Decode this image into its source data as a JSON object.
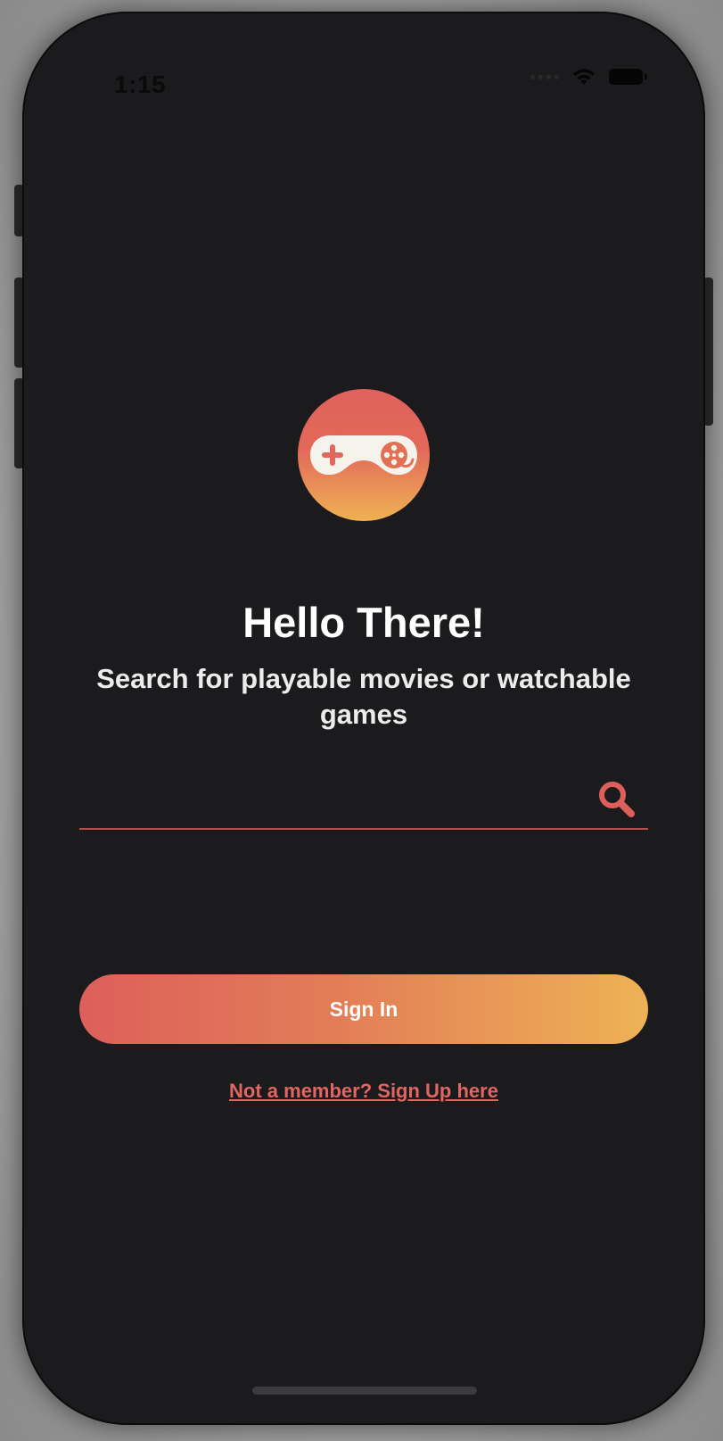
{
  "status_bar": {
    "time": "1:15",
    "icons": [
      "cellular-signal-icon",
      "wifi-icon",
      "battery-icon"
    ]
  },
  "logo": {
    "icon": "gamepad-film-reel-icon",
    "colors": [
      "#e0625b",
      "#efb253"
    ]
  },
  "welcome": {
    "title": "Hello There!",
    "subtitle": "Search for playable movies or watchable games"
  },
  "search": {
    "value": "",
    "placeholder": "",
    "icon": "search-icon",
    "accent_color": "#dc5f5a"
  },
  "actions": {
    "sign_in_label": "Sign In",
    "sign_up_link": "Not a member? Sign Up here"
  },
  "theme": {
    "background": "#1b1b1e",
    "accent_start": "#dd5f5b",
    "accent_end": "#eeb255"
  }
}
